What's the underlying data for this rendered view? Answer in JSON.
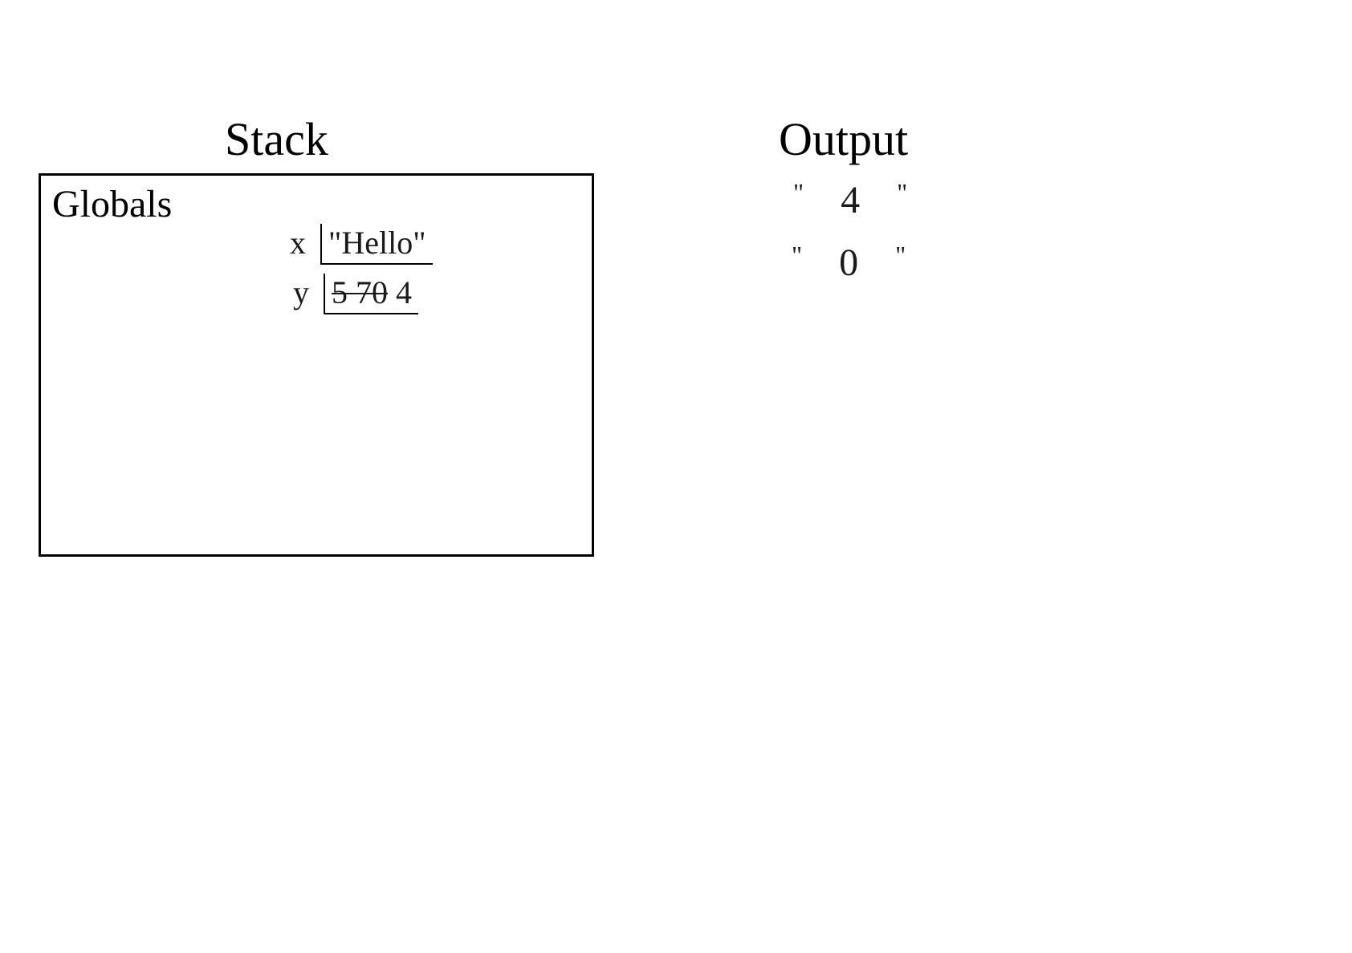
{
  "stack": {
    "title": "Stack",
    "globals_label": "Globals",
    "variables": {
      "x": {
        "name": "x",
        "value": "\"Hello\""
      },
      "y": {
        "name": "y",
        "old_value": "5 70",
        "value": "4"
      }
    }
  },
  "output": {
    "title": "Output",
    "lines": [
      "\" 4 \"",
      "\" 0 \""
    ],
    "line1_val": "4",
    "line2_val": "0"
  }
}
